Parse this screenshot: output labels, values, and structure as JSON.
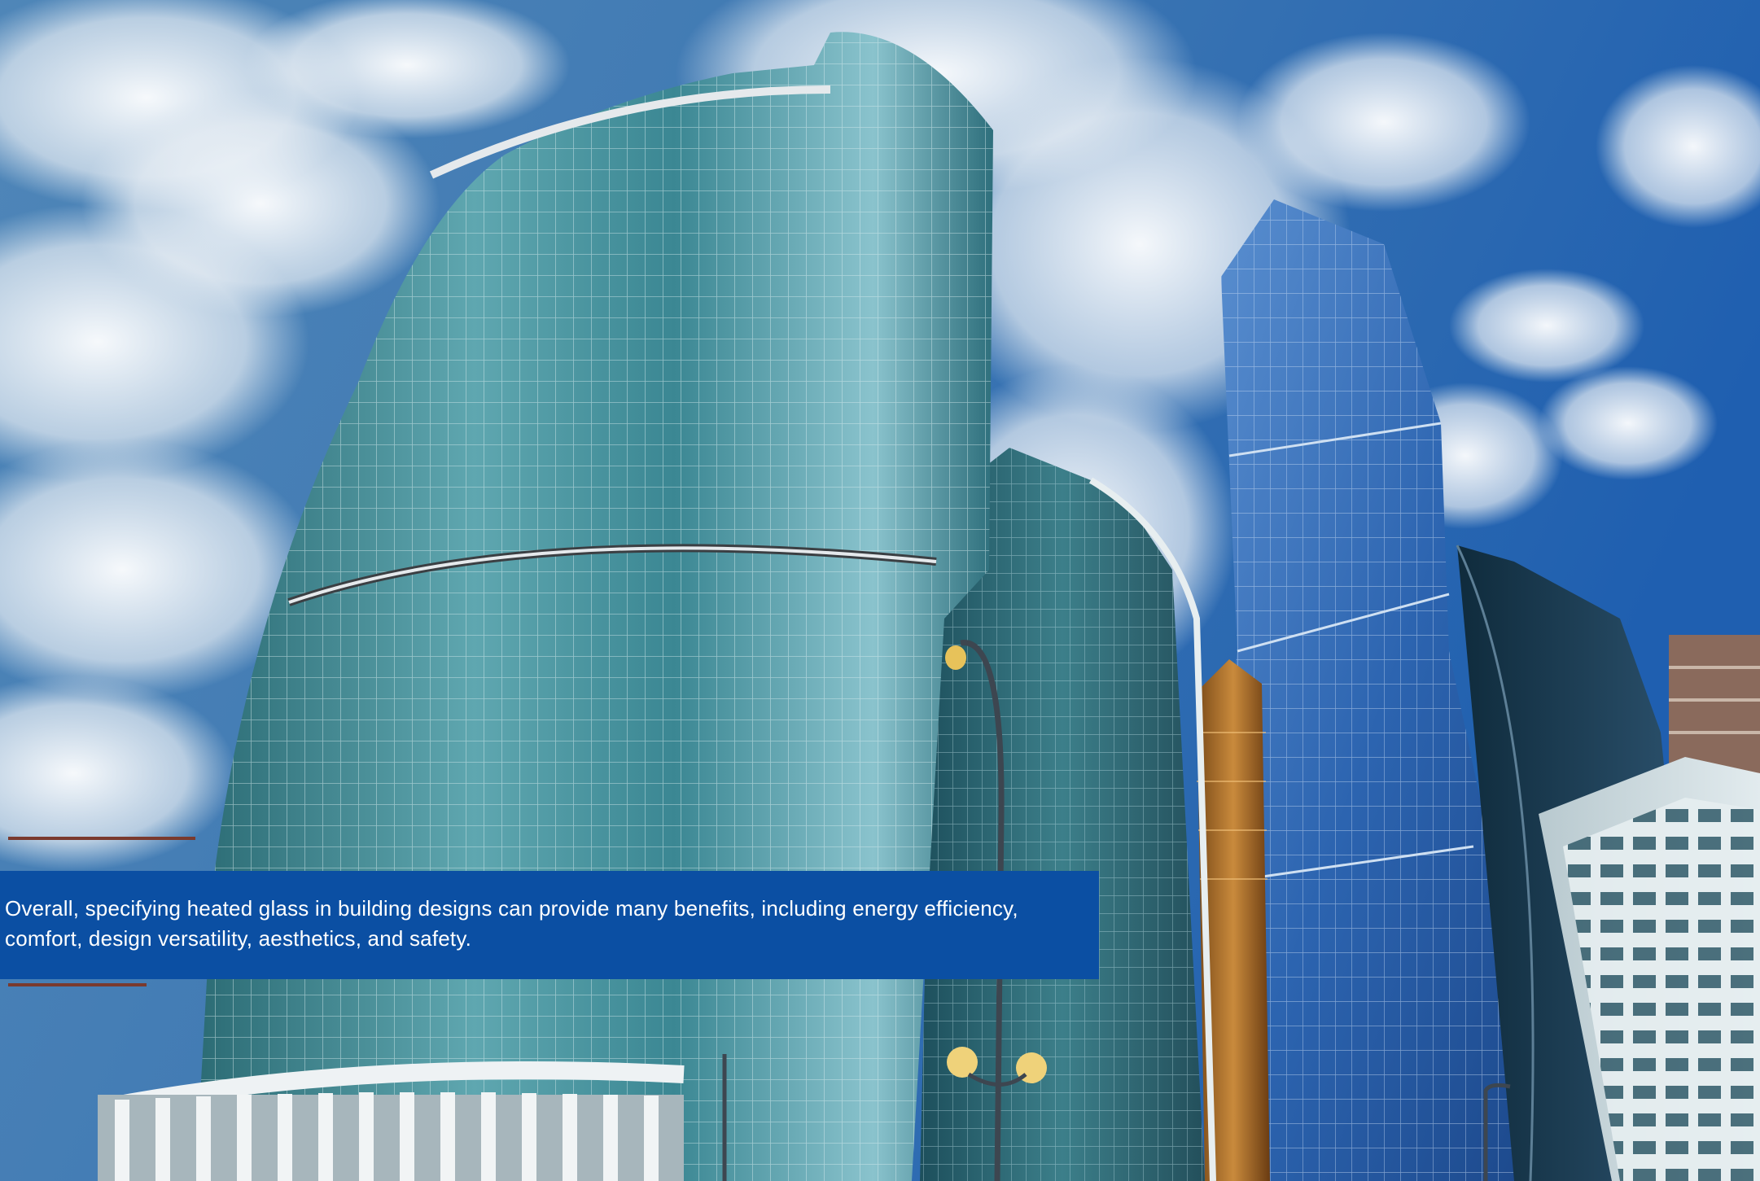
{
  "photo": {
    "subject": "glass skyscrapers against blue sky with clouds"
  },
  "caption": {
    "text": "Overall, specifying heated glass in building designs can provide many benefits, including energy efficiency, comfort, design versatility, aesthetics, and safety.",
    "background_color": "#0b4fa3",
    "text_color": "#ffffff"
  }
}
